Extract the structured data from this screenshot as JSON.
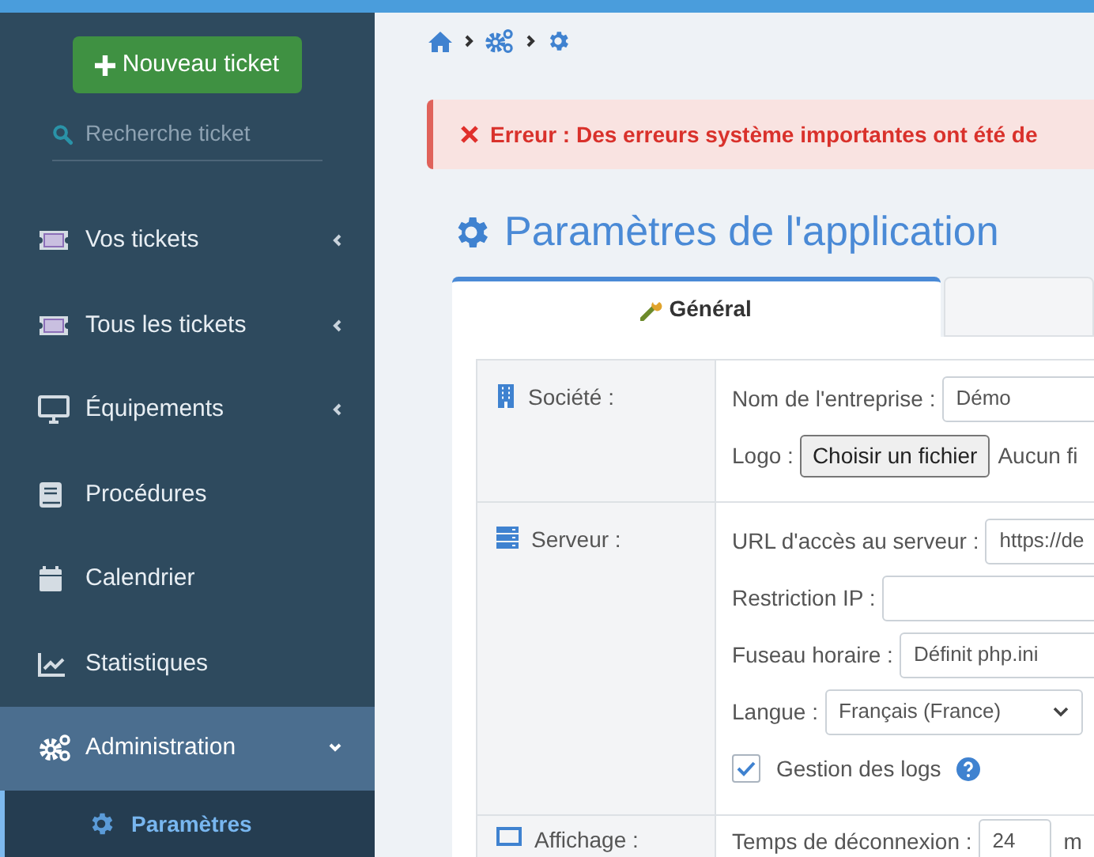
{
  "sidebar": {
    "new_button": "Nouveau ticket",
    "search": {
      "placeholder": "Recherche ticket"
    },
    "items": [
      {
        "label": "Vos tickets",
        "selected": false,
        "expanded": false
      },
      {
        "label": "Tous les tickets",
        "selected": false,
        "expanded": false
      },
      {
        "label": "Équipements",
        "selected": false,
        "expanded": false
      },
      {
        "label": "Procédures",
        "selected": false
      },
      {
        "label": "Calendrier",
        "selected": false
      },
      {
        "label": "Statistiques",
        "selected": false
      },
      {
        "label": "Administration",
        "selected": true,
        "expanded": true,
        "children": [
          {
            "label": "Paramètres",
            "selected": true
          }
        ]
      }
    ]
  },
  "alert": {
    "text": "Erreur : Des erreurs système importantes ont été de"
  },
  "page_title": "Paramètres de l'application",
  "tabs": [
    {
      "label": "Général",
      "selected": true
    },
    {
      "selected": false
    }
  ],
  "sections": [
    {
      "label": "Société :",
      "fields": [
        {
          "kind": "text",
          "label": "Nom de l'entreprise :",
          "value": "Démo"
        },
        {
          "kind": "file",
          "label": "Logo :",
          "button": "Choisir un fichier",
          "note": "Aucun fi"
        }
      ]
    },
    {
      "label": "Serveur :",
      "fields": [
        {
          "kind": "text",
          "label": "URL d'accès au serveur :",
          "value": "https://de"
        },
        {
          "kind": "text",
          "label": "Restriction IP :"
        },
        {
          "kind": "text",
          "label": "Fuseau horaire :",
          "value": "Définit php.ini"
        },
        {
          "kind": "select",
          "label": "Langue :",
          "value": "Français (France)"
        },
        {
          "kind": "checkbox",
          "label": "Gestion des logs",
          "checked": true,
          "help": true
        }
      ]
    },
    {
      "label": "Affichage :",
      "fields": [
        {
          "kind": "number",
          "label": "Temps de déconnexion :",
          "value": "24",
          "unit": "m"
        }
      ]
    }
  ]
}
